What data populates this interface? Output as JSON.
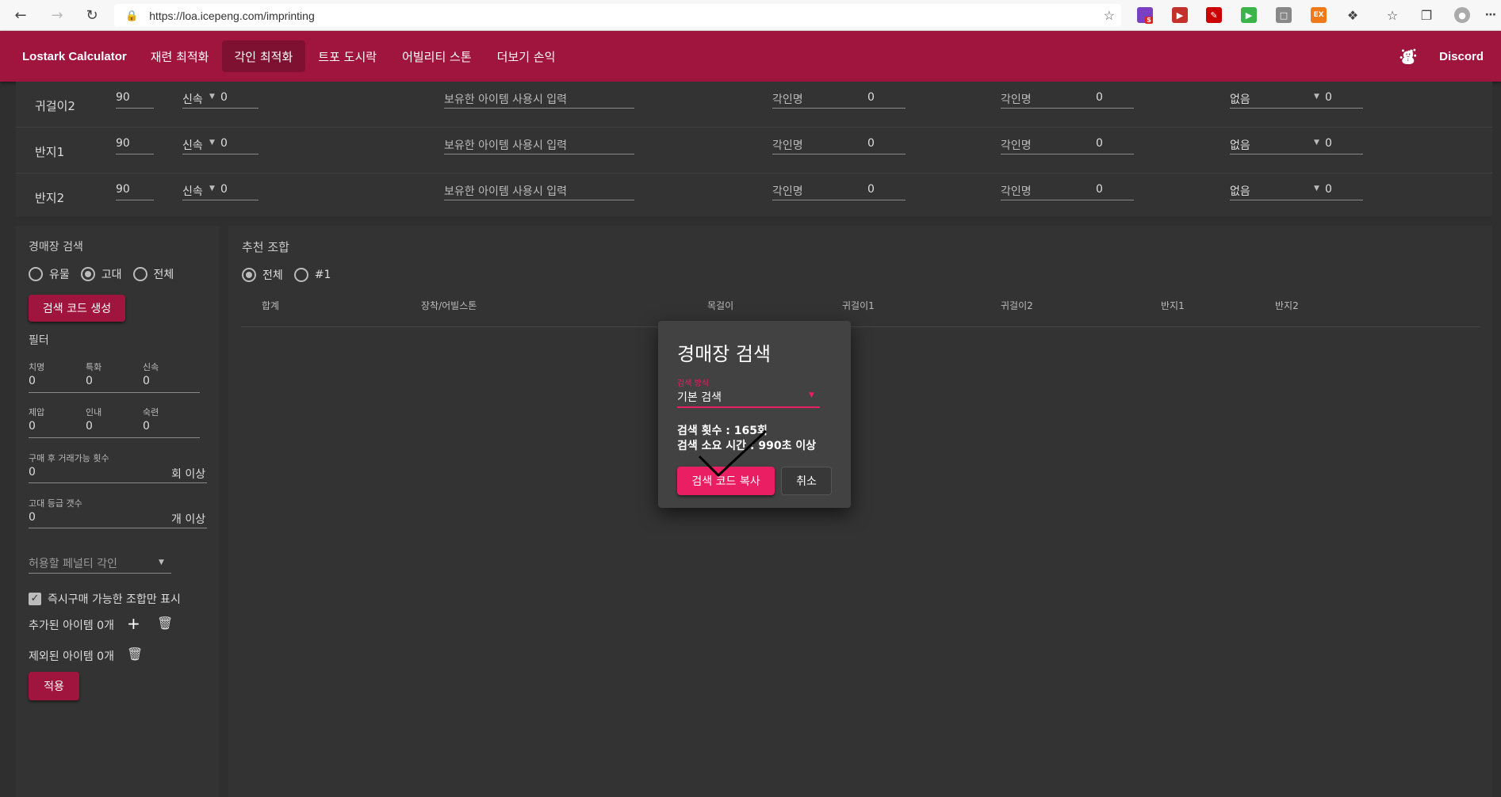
{
  "browser": {
    "url": "https://loa.icepeng.com/imprinting",
    "ext_badge": "S",
    "ext_label": "EX"
  },
  "appbar": {
    "brand": "Lostark Calculator",
    "tabs": [
      "재련 최적화",
      "각인 최적화",
      "트포 도시락",
      "어빌리티 스톤",
      "더보기 손익"
    ],
    "active_tab": "각인 최적화",
    "discord": "Discord"
  },
  "gear_rows": [
    {
      "name": "귀걸이2",
      "quality": "90",
      "stat": "신속",
      "stat_value": "0",
      "item_placeholder": "보유한 아이템 사용시 입력",
      "engr1_label": "각인명",
      "engr1_value": "0",
      "engr2_label": "각인명",
      "engr2_value": "0",
      "penalty": "없음",
      "penalty_value": "0"
    },
    {
      "name": "반지1",
      "quality": "90",
      "stat": "신속",
      "stat_value": "0",
      "item_placeholder": "보유한 아이템 사용시 입력",
      "engr1_label": "각인명",
      "engr1_value": "0",
      "engr2_label": "각인명",
      "engr2_value": "0",
      "penalty": "없음",
      "penalty_value": "0"
    },
    {
      "name": "반지2",
      "quality": "90",
      "stat": "신속",
      "stat_value": "0",
      "item_placeholder": "보유한 아이템 사용시 입력",
      "engr1_label": "각인명",
      "engr1_value": "0",
      "engr2_label": "각인명",
      "engr2_value": "0",
      "penalty": "없음",
      "penalty_value": "0"
    }
  ],
  "left": {
    "title": "경매장 검색",
    "grade_options": [
      "유물",
      "고대",
      "전체"
    ],
    "grade_selected": "고대",
    "gen_button": "검색 코드 생성",
    "filter_title": "필터",
    "stats1": [
      {
        "label": "치명",
        "value": "0"
      },
      {
        "label": "특화",
        "value": "0"
      },
      {
        "label": "신속",
        "value": "0"
      }
    ],
    "stats2": [
      {
        "label": "제압",
        "value": "0"
      },
      {
        "label": "인내",
        "value": "0"
      },
      {
        "label": "숙련",
        "value": "0"
      }
    ],
    "trade_label": "구매 후 거래가능 횟수",
    "trade_value": "0",
    "trade_suffix": "회 이상",
    "ancient_label": "고대 등급 갯수",
    "ancient_value": "0",
    "ancient_suffix": "개 이상",
    "penalty_placeholder": "허용할 페널티 각인",
    "instant_buy_label": "즉시구매 가능한 조합만 표시",
    "instant_buy_checked": true,
    "added_items": "추가된 아이템 0개",
    "excluded_items": "제외된 아이템 0개",
    "apply_button": "적용"
  },
  "right": {
    "title": "추천 조합",
    "filter_options": [
      "전체",
      "#1"
    ],
    "filter_selected": "전체",
    "columns": [
      "합계",
      "장착/어빌스톤",
      "목걸이",
      "귀걸이1",
      "귀걸이2",
      "반지1",
      "반지2"
    ]
  },
  "dialog": {
    "title": "경매장 검색",
    "select_label": "검색 방식",
    "select_value": "기본 검색",
    "search_count": "검색 횟수 : 165회",
    "search_time": "검색 소요 시간 : 990초 이상",
    "copy_button": "검색 코드 복사",
    "cancel_button": "취소"
  },
  "colors": {
    "brand": "#a0153e",
    "accent": "#e91e63",
    "panel": "#333333",
    "background": "#2f2f2f"
  }
}
